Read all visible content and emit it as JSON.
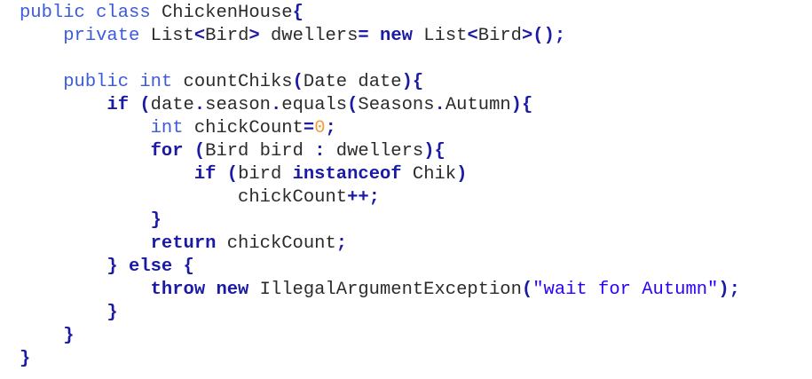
{
  "editor": {
    "language": "java",
    "colors": {
      "keyword_light": "#3b5bd9",
      "keyword_bold": "#1a1aa6",
      "plain": "#2b2b2b",
      "number": "#f39c3e",
      "string": "#2a00ff"
    },
    "lines": [
      {
        "tokens": [
          {
            "t": "public class ",
            "c": "kwl"
          },
          {
            "t": "ChickenHouse",
            "c": "plain"
          },
          {
            "t": "{",
            "c": "punc"
          }
        ]
      },
      {
        "tokens": [
          {
            "t": "    ",
            "c": "plain"
          },
          {
            "t": "private ",
            "c": "kwl"
          },
          {
            "t": "List",
            "c": "plain"
          },
          {
            "t": "<",
            "c": "punc"
          },
          {
            "t": "Bird",
            "c": "plain"
          },
          {
            "t": "> ",
            "c": "punc"
          },
          {
            "t": "dwellers",
            "c": "plain"
          },
          {
            "t": "= ",
            "c": "punc"
          },
          {
            "t": "new ",
            "c": "bold"
          },
          {
            "t": "List",
            "c": "plain"
          },
          {
            "t": "<",
            "c": "punc"
          },
          {
            "t": "Bird",
            "c": "plain"
          },
          {
            "t": ">();",
            "c": "punc"
          }
        ]
      },
      {
        "tokens": []
      },
      {
        "tokens": [
          {
            "t": "    ",
            "c": "plain"
          },
          {
            "t": "public int ",
            "c": "kwl"
          },
          {
            "t": "countChiks",
            "c": "plain"
          },
          {
            "t": "(",
            "c": "punc"
          },
          {
            "t": "Date date",
            "c": "plain"
          },
          {
            "t": "){",
            "c": "punc"
          }
        ]
      },
      {
        "tokens": [
          {
            "t": "        ",
            "c": "plain"
          },
          {
            "t": "if ",
            "c": "bold"
          },
          {
            "t": "(",
            "c": "punc"
          },
          {
            "t": "date",
            "c": "plain"
          },
          {
            "t": ".",
            "c": "punc"
          },
          {
            "t": "season",
            "c": "plain"
          },
          {
            "t": ".",
            "c": "punc"
          },
          {
            "t": "equals",
            "c": "plain"
          },
          {
            "t": "(",
            "c": "punc"
          },
          {
            "t": "Seasons",
            "c": "plain"
          },
          {
            "t": ".",
            "c": "punc"
          },
          {
            "t": "Autumn",
            "c": "plain"
          },
          {
            "t": "){",
            "c": "punc"
          }
        ]
      },
      {
        "tokens": [
          {
            "t": "            ",
            "c": "plain"
          },
          {
            "t": "int ",
            "c": "kwl"
          },
          {
            "t": "chickCount",
            "c": "plain"
          },
          {
            "t": "=",
            "c": "punc"
          },
          {
            "t": "0",
            "c": "num"
          },
          {
            "t": ";",
            "c": "punc"
          }
        ]
      },
      {
        "tokens": [
          {
            "t": "            ",
            "c": "plain"
          },
          {
            "t": "for ",
            "c": "bold"
          },
          {
            "t": "(",
            "c": "punc"
          },
          {
            "t": "Bird bird ",
            "c": "plain"
          },
          {
            "t": ": ",
            "c": "punc"
          },
          {
            "t": "dwellers",
            "c": "plain"
          },
          {
            "t": "){",
            "c": "punc"
          }
        ]
      },
      {
        "tokens": [
          {
            "t": "                ",
            "c": "plain"
          },
          {
            "t": "if ",
            "c": "bold"
          },
          {
            "t": "(",
            "c": "punc"
          },
          {
            "t": "bird ",
            "c": "plain"
          },
          {
            "t": "instanceof ",
            "c": "bold"
          },
          {
            "t": "Chik",
            "c": "plain"
          },
          {
            "t": ")",
            "c": "punc"
          }
        ]
      },
      {
        "tokens": [
          {
            "t": "                    ",
            "c": "plain"
          },
          {
            "t": "chickCount",
            "c": "plain"
          },
          {
            "t": "++;",
            "c": "punc"
          }
        ]
      },
      {
        "tokens": [
          {
            "t": "            ",
            "c": "plain"
          },
          {
            "t": "}",
            "c": "punc"
          }
        ]
      },
      {
        "tokens": [
          {
            "t": "            ",
            "c": "plain"
          },
          {
            "t": "return ",
            "c": "bold"
          },
          {
            "t": "chickCount",
            "c": "plain"
          },
          {
            "t": ";",
            "c": "punc"
          }
        ]
      },
      {
        "tokens": [
          {
            "t": "        ",
            "c": "plain"
          },
          {
            "t": "} ",
            "c": "punc"
          },
          {
            "t": "else ",
            "c": "bold"
          },
          {
            "t": "{",
            "c": "punc"
          }
        ]
      },
      {
        "tokens": [
          {
            "t": "            ",
            "c": "plain"
          },
          {
            "t": "throw ",
            "c": "bold"
          },
          {
            "t": "new ",
            "c": "bold"
          },
          {
            "t": "IllegalArgumentException",
            "c": "plain"
          },
          {
            "t": "(",
            "c": "punc"
          },
          {
            "t": "\"wait for Autumn\"",
            "c": "str"
          },
          {
            "t": ");",
            "c": "punc"
          }
        ]
      },
      {
        "tokens": [
          {
            "t": "        ",
            "c": "plain"
          },
          {
            "t": "}",
            "c": "punc"
          }
        ]
      },
      {
        "tokens": [
          {
            "t": "    ",
            "c": "plain"
          },
          {
            "t": "}",
            "c": "punc"
          }
        ]
      },
      {
        "tokens": [
          {
            "t": "}",
            "c": "punc"
          }
        ]
      }
    ]
  }
}
